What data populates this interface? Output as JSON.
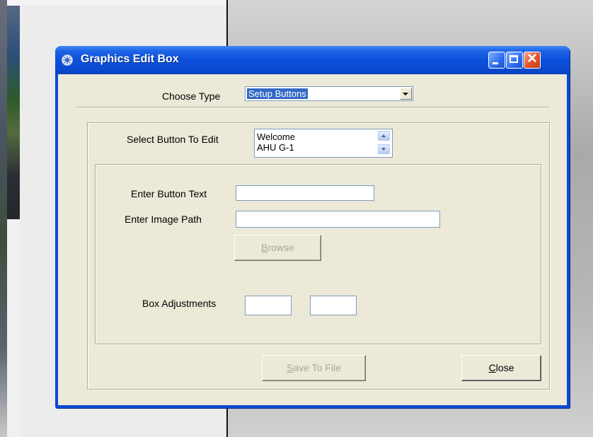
{
  "window": {
    "title": "Graphics Edit Box",
    "controls": {
      "minimize": "minimize",
      "maximize": "maximize",
      "close": "close"
    }
  },
  "type_chooser": {
    "label": "Choose Type",
    "selected": "Setup Buttons"
  },
  "button_select": {
    "label": "Select Button To Edit",
    "items": [
      "Welcome",
      "AHU G-1"
    ]
  },
  "fields": {
    "button_text_label": "Enter Button Text",
    "button_text_value": "",
    "image_path_label": "Enter Image Path",
    "image_path_value": "",
    "browse_label": "Browse",
    "browse_access_key": "B",
    "browse_rest": "rowse",
    "box_adjust_label": "Box Adjustments",
    "box_adjust_1": "",
    "box_adjust_2": ""
  },
  "actions": {
    "save_access_key": "S",
    "save_rest": "ave To File",
    "close_access_key": "C",
    "close_rest": "lose"
  },
  "colors": {
    "title_bar": "#0c50da",
    "dialog_face": "#ece9d8",
    "selection": "#316ac5",
    "close_button": "#e0502a",
    "disabled_text": "#aca899"
  }
}
